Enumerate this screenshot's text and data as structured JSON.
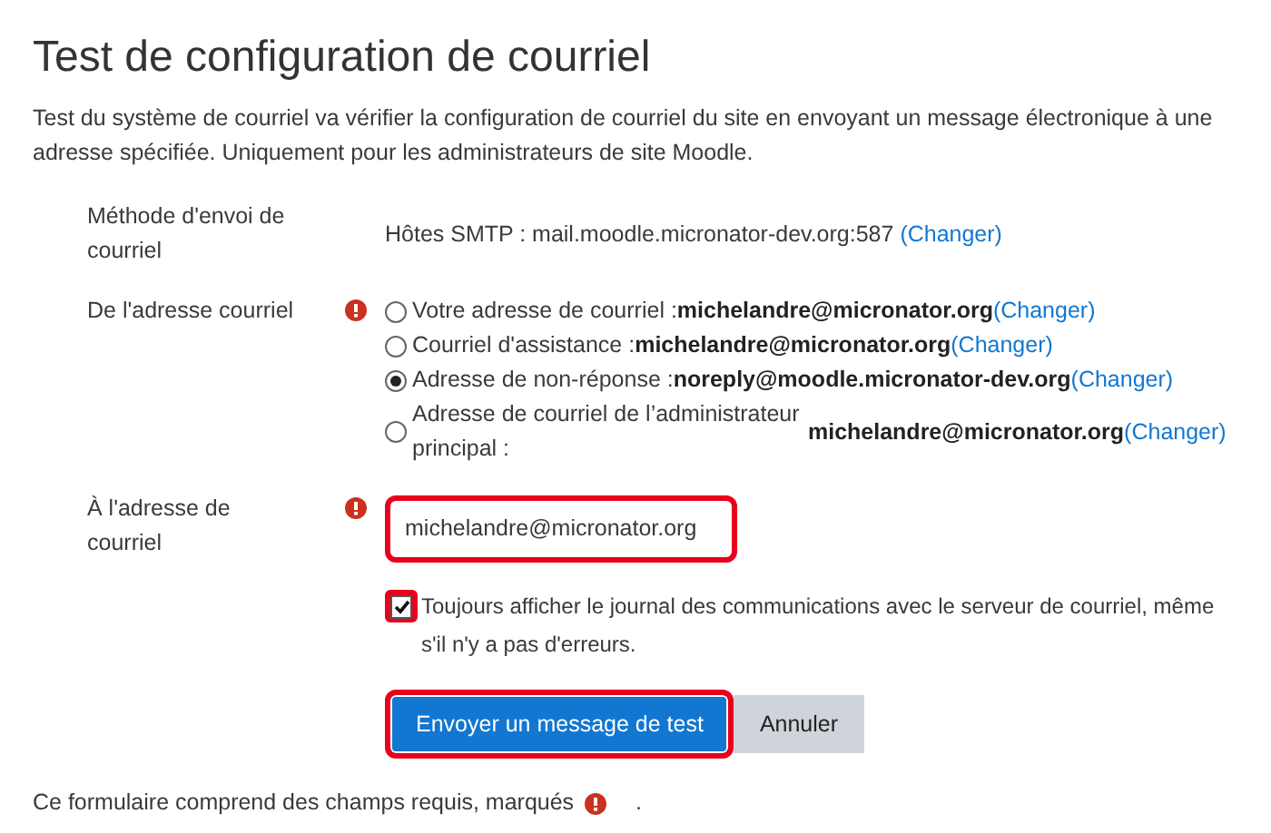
{
  "title": "Test de configuration de courriel",
  "intro": "Test du système de courriel va vérifier la configuration de courriel du site en envoyant un message électronique à une adresse spécifiée. Uniquement pour les administrateurs de site Moodle.",
  "method": {
    "label": "Méthode d'envoi de courriel",
    "value": "Hôtes SMTP : mail.moodle.micronator-dev.org:587 ",
    "link": "(Changer)"
  },
  "from": {
    "label": "De l'adresse courriel",
    "required": true,
    "options": [
      {
        "kind": "inline",
        "label": "Votre adresse de courriel :",
        "value": "michelandre@micronator.org",
        "link": "(Changer)",
        "selected": false
      },
      {
        "kind": "inline",
        "label": "Courriel d'assistance :",
        "value": "michelandre@micronator.org",
        "link": "(Changer)",
        "selected": false
      },
      {
        "kind": "inline",
        "label": "Adresse de non-réponse :",
        "value": "noreply@moodle.micronator-dev.org",
        "link": "(Changer)",
        "selected": true
      },
      {
        "kind": "stacked",
        "label": "Adresse de courriel de l’administrateur principal :",
        "value": "michelandre@micronator.org",
        "link": "(Changer)",
        "selected": false
      }
    ]
  },
  "to": {
    "label": "À l'adresse de courriel",
    "required": true,
    "value": "michelandre@micronator.org",
    "highlighted": true
  },
  "log_option": {
    "label": "Toujours afficher le journal des communications avec le serveur de courriel, même s'il n'y a pas d'erreurs.",
    "checked": true,
    "highlighted": true
  },
  "buttons": [
    {
      "kind": "primary",
      "label": "Envoyer un message de test",
      "highlighted": true
    },
    {
      "kind": "secondary",
      "label": "Annuler",
      "highlighted": false
    }
  ],
  "footer": {
    "text": "Ce formulaire comprend des champs requis, marqués",
    "suffix": "."
  }
}
